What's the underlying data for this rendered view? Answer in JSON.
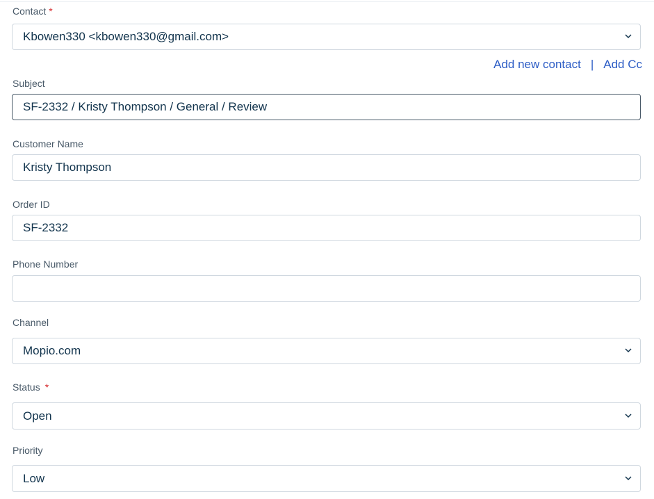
{
  "contact": {
    "label": "Contact",
    "required_mark": "*",
    "value": "Kbowen330 <kbowen330@gmail.com>"
  },
  "contact_links": {
    "add_new_contact": "Add new contact",
    "separator": "|",
    "add_cc": "Add Cc"
  },
  "subject": {
    "label": "Subject",
    "value": "SF-2332 / Kristy Thompson / General / Review"
  },
  "customer_name": {
    "label": "Customer Name",
    "value": "Kristy Thompson"
  },
  "order_id": {
    "label": "Order ID",
    "value": "SF-2332"
  },
  "phone_number": {
    "label": "Phone Number",
    "value": ""
  },
  "channel": {
    "label": "Channel",
    "value": "Mopio.com"
  },
  "status": {
    "label": "Status",
    "required_mark": "*",
    "value": "Open"
  },
  "priority": {
    "label": "Priority",
    "value": "Low"
  },
  "icons": {
    "dropdown": "chevron-down-icon"
  },
  "colors": {
    "link": "#2c5cc5",
    "required": "#d72d30",
    "text": "#12344d",
    "label": "#475867",
    "border": "#cfd7df"
  }
}
